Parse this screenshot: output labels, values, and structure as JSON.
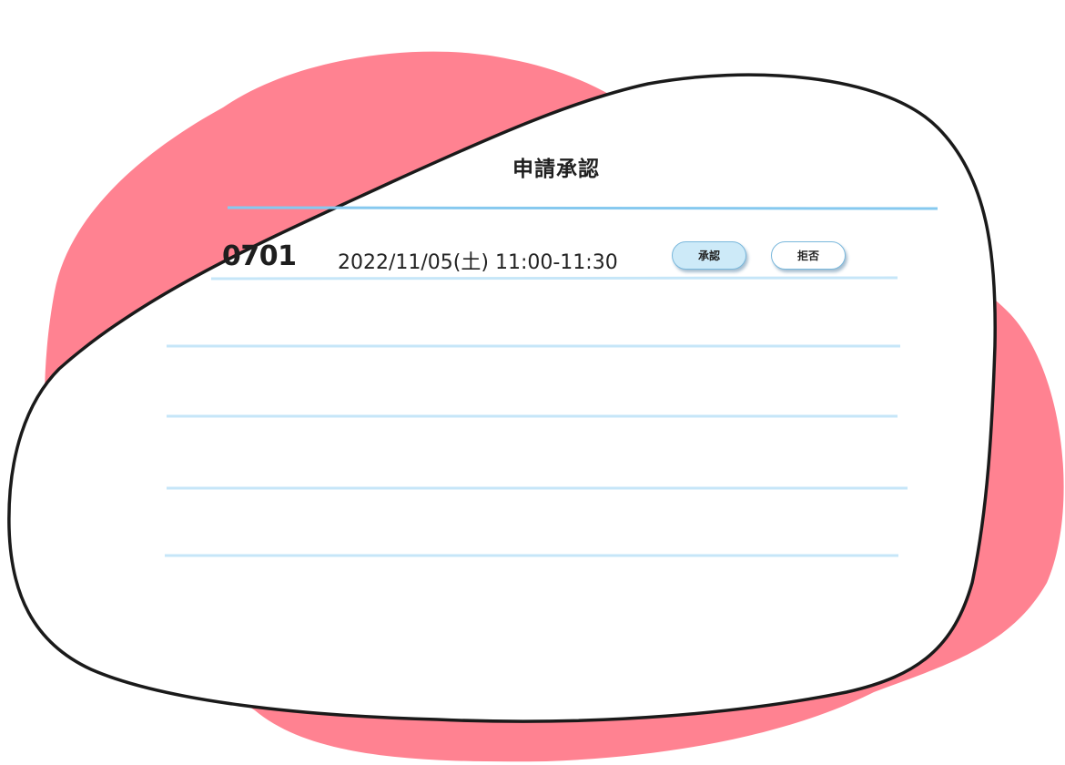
{
  "header": {
    "title": "申請承認"
  },
  "requests": [
    {
      "id_partial": "0701",
      "datetime": "2022/11/05(土) 11:00-11:30",
      "approve_label": "承認",
      "reject_label": "拒否"
    }
  ],
  "colors": {
    "blob_pink": "#ff8291",
    "blob_outline": "#1a1a1a",
    "header_rule": "#86c9ef",
    "row_rule": "#c6e6f8",
    "approve_fill": "#cdeaf8"
  }
}
